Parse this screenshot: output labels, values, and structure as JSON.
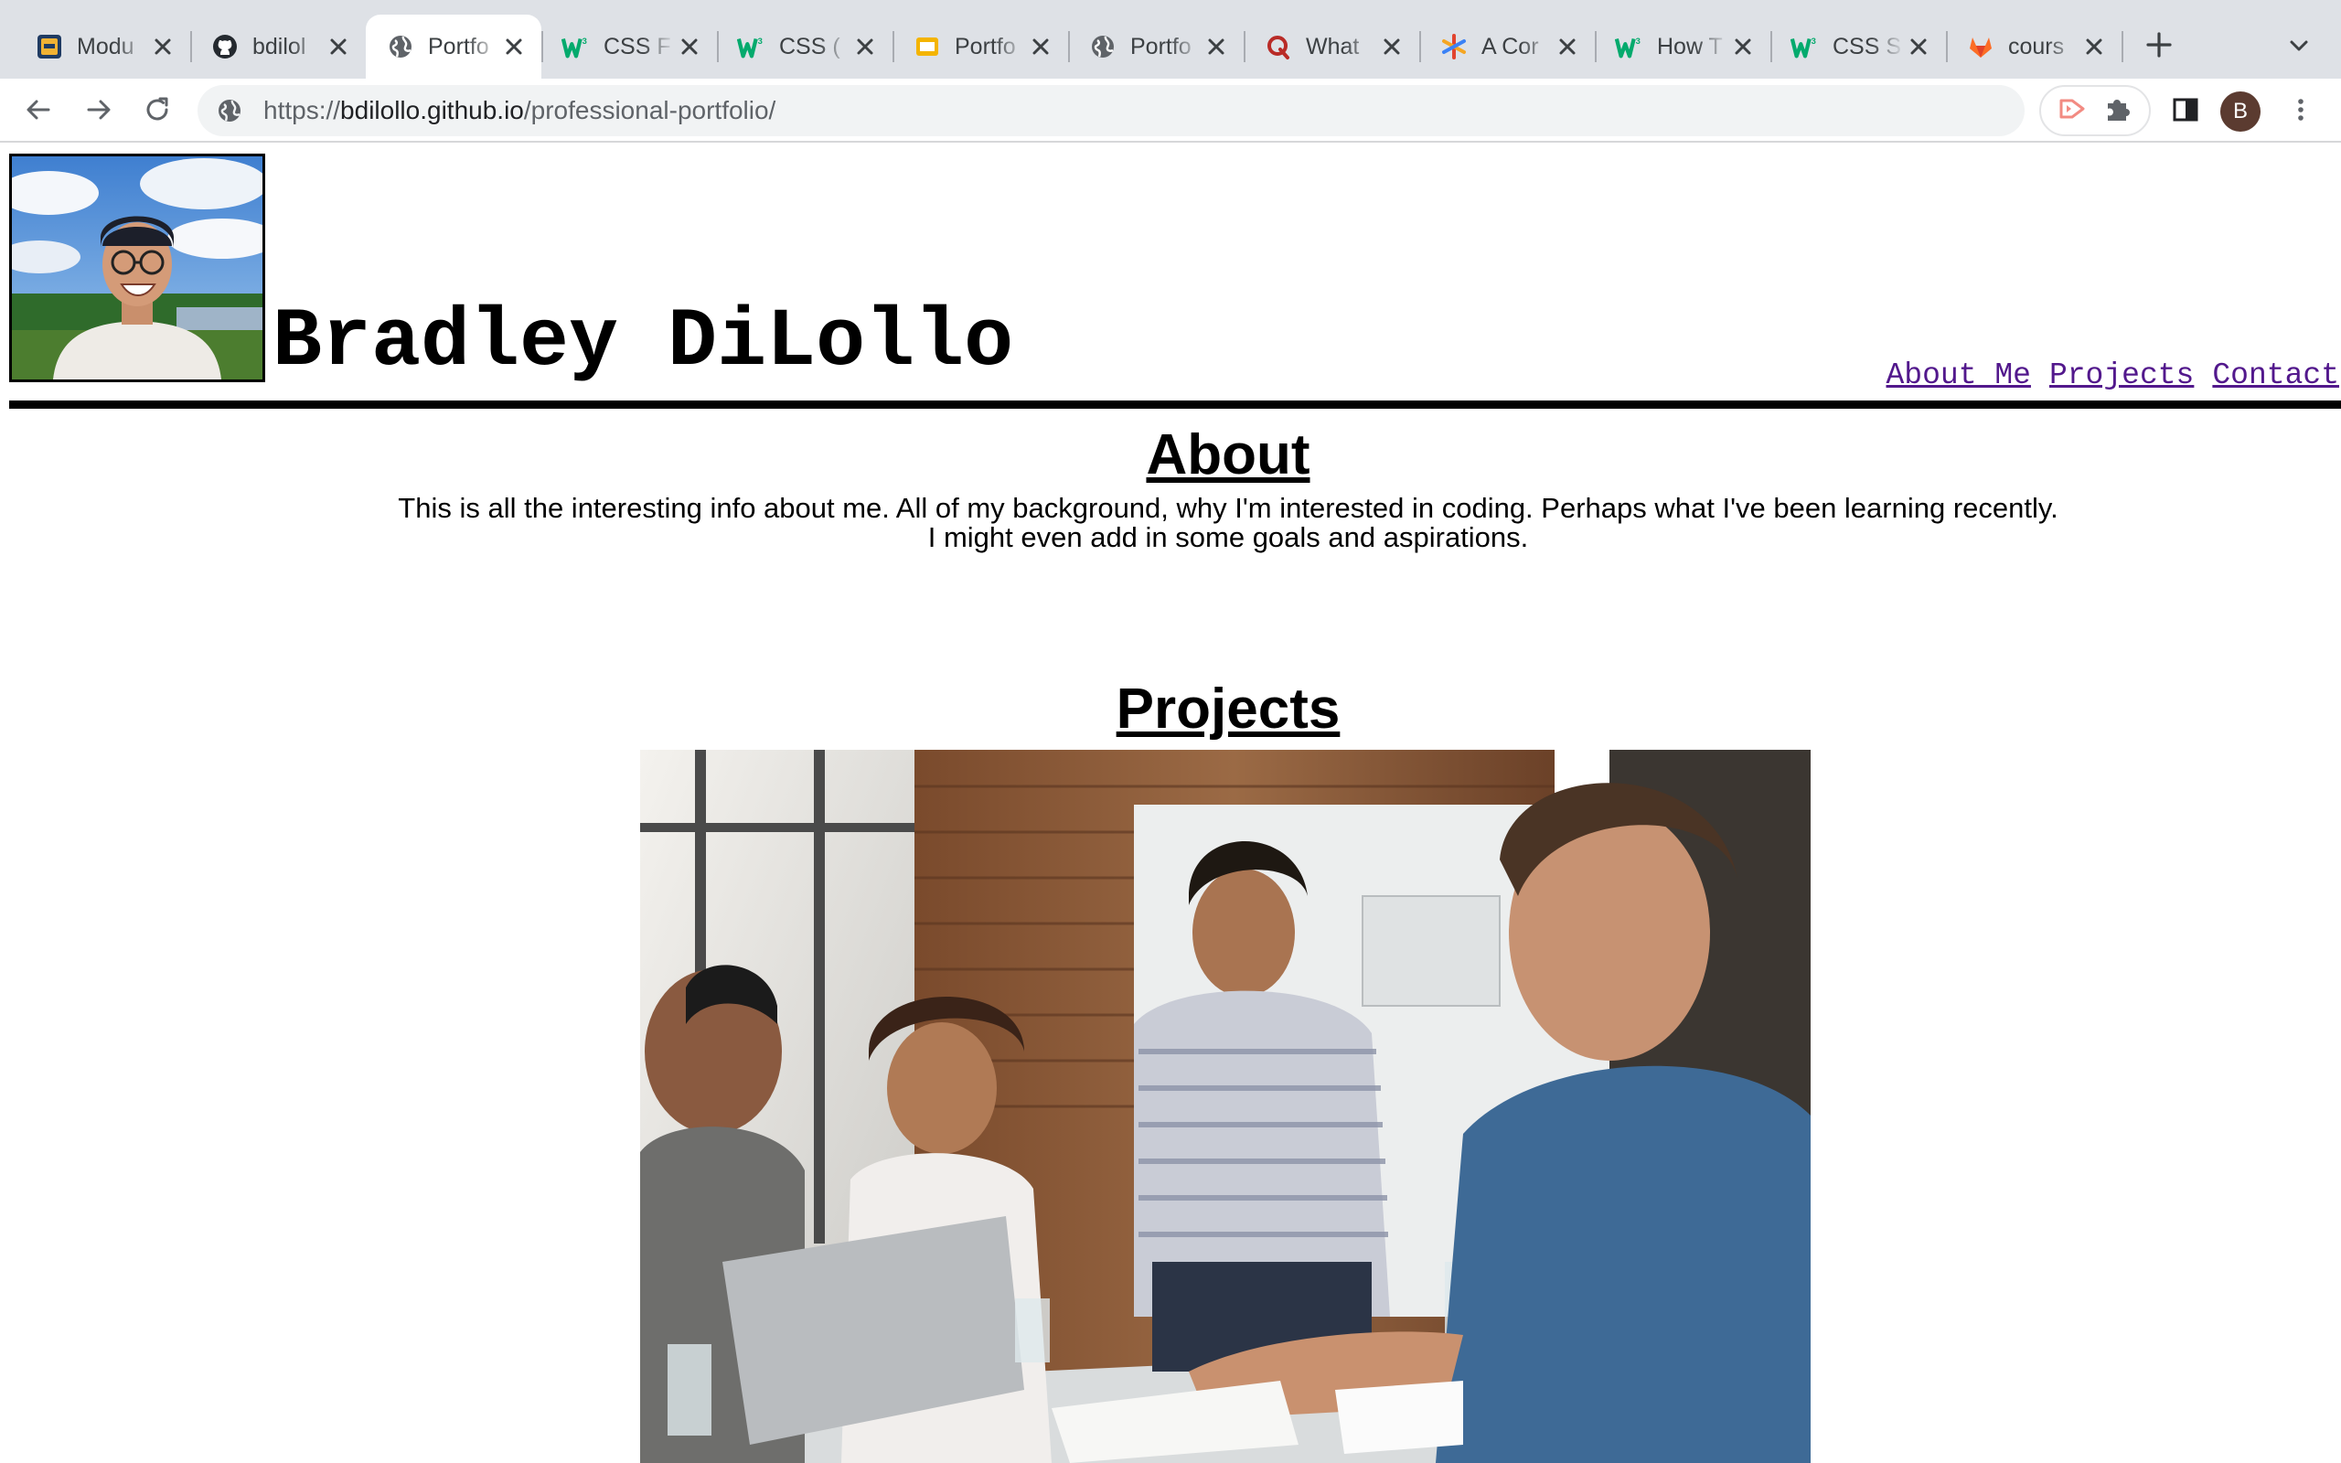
{
  "browser": {
    "tabs": [
      {
        "title": "Modu",
        "icon": "module-favicon-icon",
        "active": false
      },
      {
        "title": "bdilol",
        "icon": "github-icon",
        "active": false
      },
      {
        "title": "Portfo",
        "icon": "globe-icon",
        "active": true
      },
      {
        "title": "CSS F",
        "icon": "w3schools-icon",
        "active": false
      },
      {
        "title": "CSS (",
        "icon": "w3schools-icon",
        "active": false
      },
      {
        "title": "Portfo",
        "icon": "slides-icon",
        "active": false
      },
      {
        "title": "Portfo",
        "icon": "globe-icon",
        "active": false
      },
      {
        "title": "What",
        "icon": "quora-icon",
        "active": false
      },
      {
        "title": "A Cor",
        "icon": "asterisk-icon",
        "active": false
      },
      {
        "title": "How T",
        "icon": "w3schools-icon",
        "active": false
      },
      {
        "title": "CSS S",
        "icon": "w3schools-icon",
        "active": false
      },
      {
        "title": "cours",
        "icon": "gitlab-icon",
        "active": false
      }
    ],
    "url_prefix": "https://",
    "url_host": "bdilollo.github.io",
    "url_path": "/professional-portfolio/",
    "profile_initial": "B",
    "colors": {
      "tabstrip": "#dee1e6",
      "omnibox": "#f1f3f4",
      "avatar": "#5b3b30"
    }
  },
  "site": {
    "name": "Bradley DiLollo",
    "nav": [
      "About Me",
      "Projects",
      "Contact"
    ],
    "about": {
      "heading": "About",
      "lines": [
        "This is all the interesting info about me. All of my background, why I'm interested in coding. Perhaps what I've been learning recently.",
        "I might even add in some goals and aspirations."
      ]
    },
    "projects": {
      "heading": "Projects"
    },
    "colors": {
      "link": "#52188c",
      "rule": "#000000"
    }
  }
}
